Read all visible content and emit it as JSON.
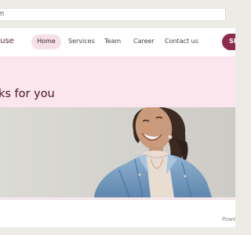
{
  "browser": {
    "url_fragment": "m"
  },
  "header": {
    "brand_fragment": "ouse",
    "nav": {
      "home": "Home",
      "services": "Services",
      "team": "Team",
      "career": "Career",
      "contact": "Contact us"
    },
    "cta_fragment": "Sh"
  },
  "hero": {
    "title_fragment": "ks for you"
  },
  "footer": {
    "text_fragment": "Powe"
  },
  "colors": {
    "brand": "#5b1f34",
    "accent": "#8f2a4f",
    "hero_background": "#fbe6ee",
    "active_nav_pill": "#f7dfe8"
  }
}
